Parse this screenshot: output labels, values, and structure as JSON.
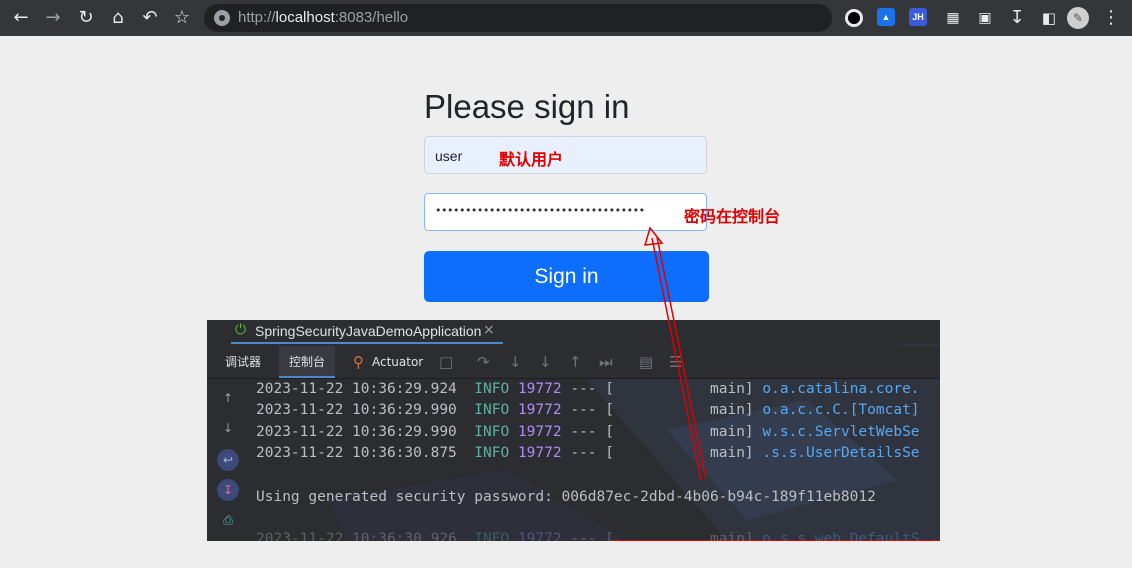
{
  "browser": {
    "url_scheme": "http://",
    "url_host": "localhost",
    "url_rest": ":8083/hello",
    "extensions": [
      "JH"
    ]
  },
  "login": {
    "title": "Please sign in",
    "username_value": "user",
    "password_masked": "•••••••••••••••••••••••••••••••••••",
    "submit_label": "Sign in"
  },
  "annotations": {
    "default_user": "默认用户",
    "password_hint": "密码在控制台",
    "color": "#e00000"
  },
  "ide": {
    "run_tab": "SpringSecurityJavaDemoApplication",
    "toolbar_tabs": [
      "调试器",
      "控制台",
      "Actuator"
    ],
    "logs": [
      {
        "time": "2023-11-22 10:36:29.924",
        "level": "INFO",
        "pid": "19772",
        "sep": "--- [",
        "thread": "main]",
        "logger": "o.a.catalina.core."
      },
      {
        "time": "2023-11-22 10:36:29.990",
        "level": "INFO",
        "pid": "19772",
        "sep": "--- [",
        "thread": "main]",
        "logger": "o.a.c.c.C.[Tomcat]"
      },
      {
        "time": "2023-11-22 10:36:29.990",
        "level": "INFO",
        "pid": "19772",
        "sep": "--- [",
        "thread": "main]",
        "logger": "w.s.c.ServletWebSe"
      },
      {
        "time": "2023-11-22 10:36:30.875",
        "level": "INFO",
        "pid": "19772",
        "sep": "--- [",
        "thread": "main]",
        "logger": ".s.s.UserDetailsSe"
      }
    ],
    "password_line_label": "Using generated security password: ",
    "generated_password": "006d87ec-2dbd-4b06-b94c-189f11eb8012",
    "trailing_log": {
      "time": "2023-11-22 10:36:30.926",
      "level": "INFO",
      "pid": "19772",
      "sep": "--- [",
      "thread": "main]",
      "logger": "o.s.s.web.DefaultS"
    }
  }
}
